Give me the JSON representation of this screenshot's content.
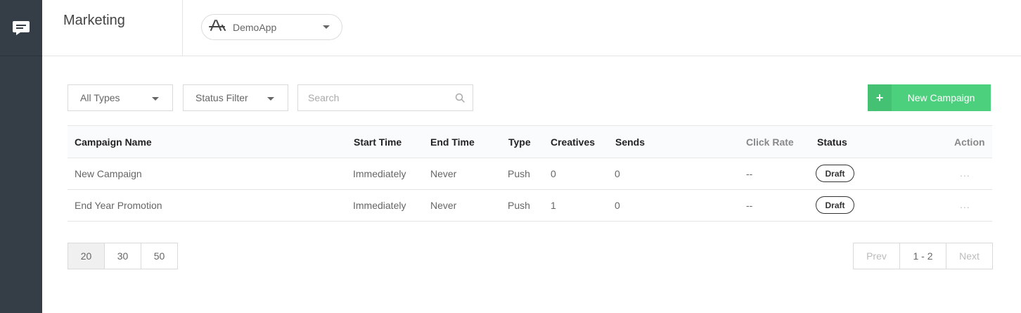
{
  "header": {
    "title": "Marketing",
    "app_selector": {
      "selected": "DemoApp",
      "icon": "app-store-icon"
    }
  },
  "filters": {
    "type_filter": "All Types",
    "status_filter": "Status Filter",
    "search_placeholder": "Search"
  },
  "actions": {
    "new_campaign_label": "New Campaign",
    "new_campaign_icon": "+"
  },
  "table": {
    "columns": [
      "Campaign Name",
      "Start Time",
      "End Time",
      "Type",
      "Creatives",
      "Sends",
      "Click Rate",
      "Status",
      "Action"
    ],
    "rows": [
      {
        "name": "New Campaign",
        "start": "Immediately",
        "end": "Never",
        "type": "Push",
        "creatives": "0",
        "sends": "0",
        "click_rate": "--",
        "status": "Draft",
        "action": "..."
      },
      {
        "name": "End Year Promotion",
        "start": "Immediately",
        "end": "Never",
        "type": "Push",
        "creatives": "1",
        "sends": "0",
        "click_rate": "--",
        "status": "Draft",
        "action": "..."
      }
    ]
  },
  "pagination": {
    "page_sizes": [
      "20",
      "30",
      "50"
    ],
    "selected_size": "20",
    "prev": "Prev",
    "range": "1 - 2",
    "next": "Next"
  },
  "colors": {
    "sidebar": "#353e47",
    "accent_green": "#4cd07d"
  }
}
